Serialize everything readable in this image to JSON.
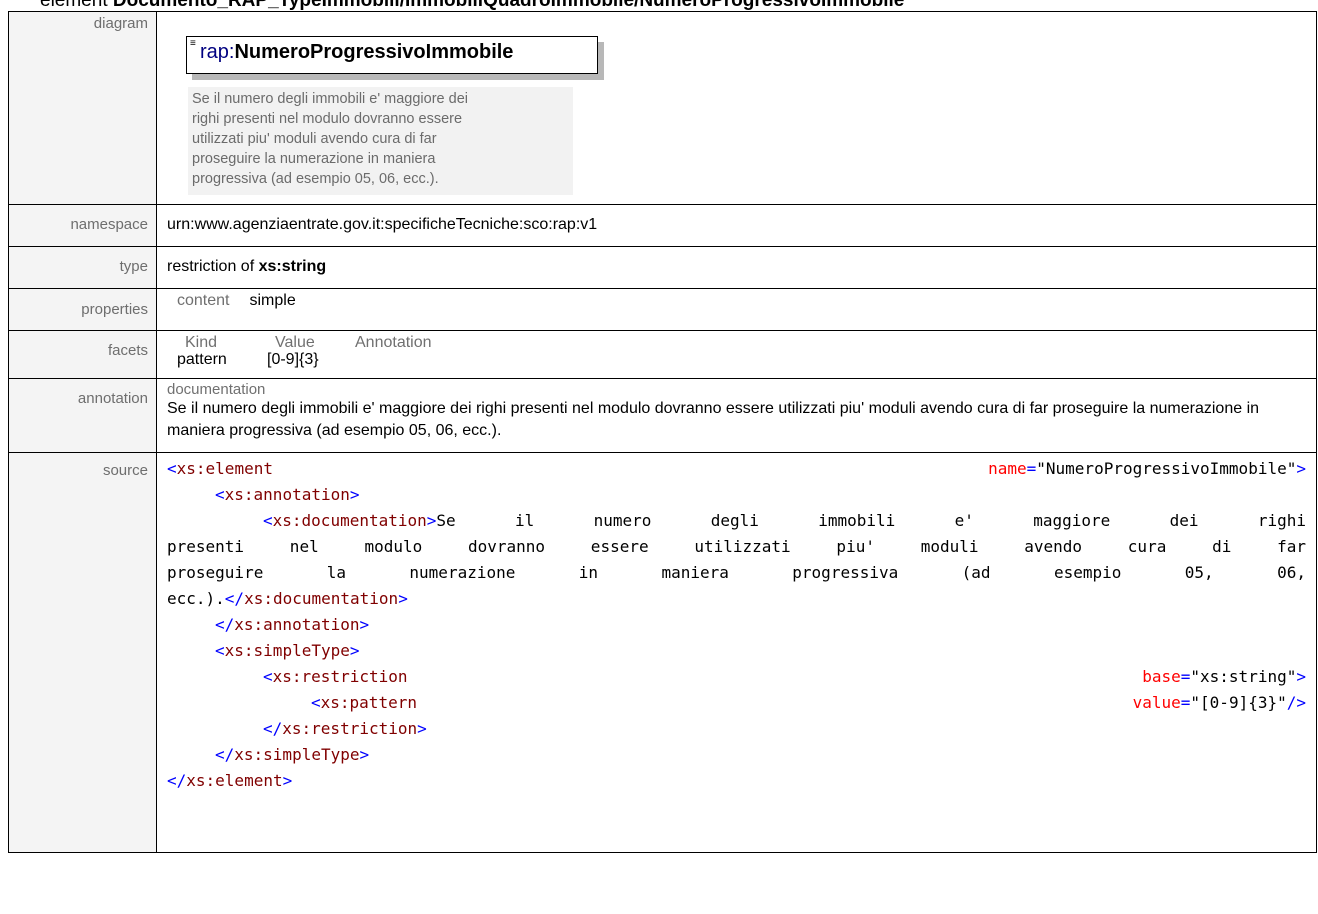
{
  "title": {
    "kind": "element",
    "path": "Documento_RAP_TypeImmobili/ImmobiliQuadroImmobile/NumeroProgressivoImmobile"
  },
  "rows": {
    "diagram": {
      "label": "diagram",
      "prefix": "rap:",
      "name": "NumeroProgressivoImmobile",
      "note_lines": [
        "Se il numero degli immobili e' maggiore dei",
        "righi presenti nel modulo dovranno essere",
        "utilizzati piu' moduli avendo cura di far",
        "proseguire la numerazione in maniera",
        "progressiva (ad esempio 05, 06, ecc.)."
      ]
    },
    "namespace": {
      "label": "namespace",
      "value": "urn:www.agenziaentrate.gov.it:specificheTecniche:sco:rap:v1"
    },
    "type": {
      "label": "type",
      "prefix": "restriction of",
      "base": "xs:string"
    },
    "properties": {
      "label": "properties",
      "key": "content",
      "value": "simple"
    },
    "facets": {
      "label": "facets",
      "headers": [
        "Kind",
        "Value",
        "Annotation"
      ],
      "rows": [
        {
          "kind": "pattern",
          "value": "[0-9]{3}",
          "annotation": ""
        }
      ]
    },
    "annotation": {
      "label": "annotation",
      "heading": "documentation",
      "text": "Se il numero degli immobili e' maggiore dei righi presenti nel modulo dovranno essere utilizzati piu' moduli avendo cura di far proseguire la numerazione in maniera progressiva (ad esempio 05, 06, ecc.)."
    },
    "source": {
      "label": "source",
      "element_tag": "xs:element",
      "element_attr": "name",
      "element_val": "\"NumeroProgressivoImmobile\"",
      "annotation_tag": "xs:annotation",
      "documentation_tag": "xs:documentation",
      "doc_line1": "Se il numero degli immobili e' maggiore dei righi",
      "doc_line2": "presenti nel modulo dovranno essere utilizzati piu' moduli avendo cura di far",
      "doc_line3": "proseguire la numerazione in maniera progressiva (ad esempio 05, 06,",
      "doc_line4": "ecc.).",
      "simpletype_tag": "xs:simpleType",
      "restriction_tag": "xs:restriction",
      "restriction_attr": "base",
      "restriction_val": "\"xs:string\"",
      "pattern_tag": "xs:pattern",
      "pattern_attr": "value",
      "pattern_val": "\"[0-9]{3}\""
    }
  }
}
